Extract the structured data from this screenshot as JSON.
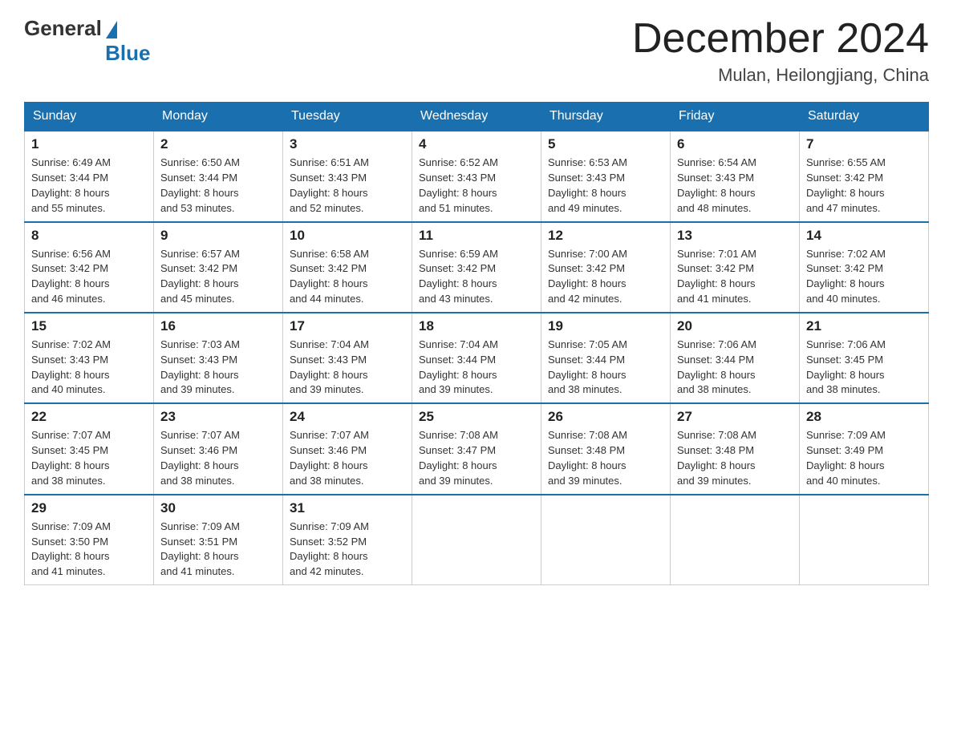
{
  "logo": {
    "general": "General",
    "blue": "Blue"
  },
  "title": "December 2024",
  "subtitle": "Mulan, Heilongjiang, China",
  "weekdays": [
    "Sunday",
    "Monday",
    "Tuesday",
    "Wednesday",
    "Thursday",
    "Friday",
    "Saturday"
  ],
  "weeks": [
    [
      {
        "day": "1",
        "sunrise": "6:49 AM",
        "sunset": "3:44 PM",
        "daylight": "8 hours and 55 minutes."
      },
      {
        "day": "2",
        "sunrise": "6:50 AM",
        "sunset": "3:44 PM",
        "daylight": "8 hours and 53 minutes."
      },
      {
        "day": "3",
        "sunrise": "6:51 AM",
        "sunset": "3:43 PM",
        "daylight": "8 hours and 52 minutes."
      },
      {
        "day": "4",
        "sunrise": "6:52 AM",
        "sunset": "3:43 PM",
        "daylight": "8 hours and 51 minutes."
      },
      {
        "day": "5",
        "sunrise": "6:53 AM",
        "sunset": "3:43 PM",
        "daylight": "8 hours and 49 minutes."
      },
      {
        "day": "6",
        "sunrise": "6:54 AM",
        "sunset": "3:43 PM",
        "daylight": "8 hours and 48 minutes."
      },
      {
        "day": "7",
        "sunrise": "6:55 AM",
        "sunset": "3:42 PM",
        "daylight": "8 hours and 47 minutes."
      }
    ],
    [
      {
        "day": "8",
        "sunrise": "6:56 AM",
        "sunset": "3:42 PM",
        "daylight": "8 hours and 46 minutes."
      },
      {
        "day": "9",
        "sunrise": "6:57 AM",
        "sunset": "3:42 PM",
        "daylight": "8 hours and 45 minutes."
      },
      {
        "day": "10",
        "sunrise": "6:58 AM",
        "sunset": "3:42 PM",
        "daylight": "8 hours and 44 minutes."
      },
      {
        "day": "11",
        "sunrise": "6:59 AM",
        "sunset": "3:42 PM",
        "daylight": "8 hours and 43 minutes."
      },
      {
        "day": "12",
        "sunrise": "7:00 AM",
        "sunset": "3:42 PM",
        "daylight": "8 hours and 42 minutes."
      },
      {
        "day": "13",
        "sunrise": "7:01 AM",
        "sunset": "3:42 PM",
        "daylight": "8 hours and 41 minutes."
      },
      {
        "day": "14",
        "sunrise": "7:02 AM",
        "sunset": "3:42 PM",
        "daylight": "8 hours and 40 minutes."
      }
    ],
    [
      {
        "day": "15",
        "sunrise": "7:02 AM",
        "sunset": "3:43 PM",
        "daylight": "8 hours and 40 minutes."
      },
      {
        "day": "16",
        "sunrise": "7:03 AM",
        "sunset": "3:43 PM",
        "daylight": "8 hours and 39 minutes."
      },
      {
        "day": "17",
        "sunrise": "7:04 AM",
        "sunset": "3:43 PM",
        "daylight": "8 hours and 39 minutes."
      },
      {
        "day": "18",
        "sunrise": "7:04 AM",
        "sunset": "3:44 PM",
        "daylight": "8 hours and 39 minutes."
      },
      {
        "day": "19",
        "sunrise": "7:05 AM",
        "sunset": "3:44 PM",
        "daylight": "8 hours and 38 minutes."
      },
      {
        "day": "20",
        "sunrise": "7:06 AM",
        "sunset": "3:44 PM",
        "daylight": "8 hours and 38 minutes."
      },
      {
        "day": "21",
        "sunrise": "7:06 AM",
        "sunset": "3:45 PM",
        "daylight": "8 hours and 38 minutes."
      }
    ],
    [
      {
        "day": "22",
        "sunrise": "7:07 AM",
        "sunset": "3:45 PM",
        "daylight": "8 hours and 38 minutes."
      },
      {
        "day": "23",
        "sunrise": "7:07 AM",
        "sunset": "3:46 PM",
        "daylight": "8 hours and 38 minutes."
      },
      {
        "day": "24",
        "sunrise": "7:07 AM",
        "sunset": "3:46 PM",
        "daylight": "8 hours and 38 minutes."
      },
      {
        "day": "25",
        "sunrise": "7:08 AM",
        "sunset": "3:47 PM",
        "daylight": "8 hours and 39 minutes."
      },
      {
        "day": "26",
        "sunrise": "7:08 AM",
        "sunset": "3:48 PM",
        "daylight": "8 hours and 39 minutes."
      },
      {
        "day": "27",
        "sunrise": "7:08 AM",
        "sunset": "3:48 PM",
        "daylight": "8 hours and 39 minutes."
      },
      {
        "day": "28",
        "sunrise": "7:09 AM",
        "sunset": "3:49 PM",
        "daylight": "8 hours and 40 minutes."
      }
    ],
    [
      {
        "day": "29",
        "sunrise": "7:09 AM",
        "sunset": "3:50 PM",
        "daylight": "8 hours and 41 minutes."
      },
      {
        "day": "30",
        "sunrise": "7:09 AM",
        "sunset": "3:51 PM",
        "daylight": "8 hours and 41 minutes."
      },
      {
        "day": "31",
        "sunrise": "7:09 AM",
        "sunset": "3:52 PM",
        "daylight": "8 hours and 42 minutes."
      },
      null,
      null,
      null,
      null
    ]
  ],
  "labels": {
    "sunrise_prefix": "Sunrise: ",
    "sunset_prefix": "Sunset: ",
    "daylight_prefix": "Daylight: "
  }
}
